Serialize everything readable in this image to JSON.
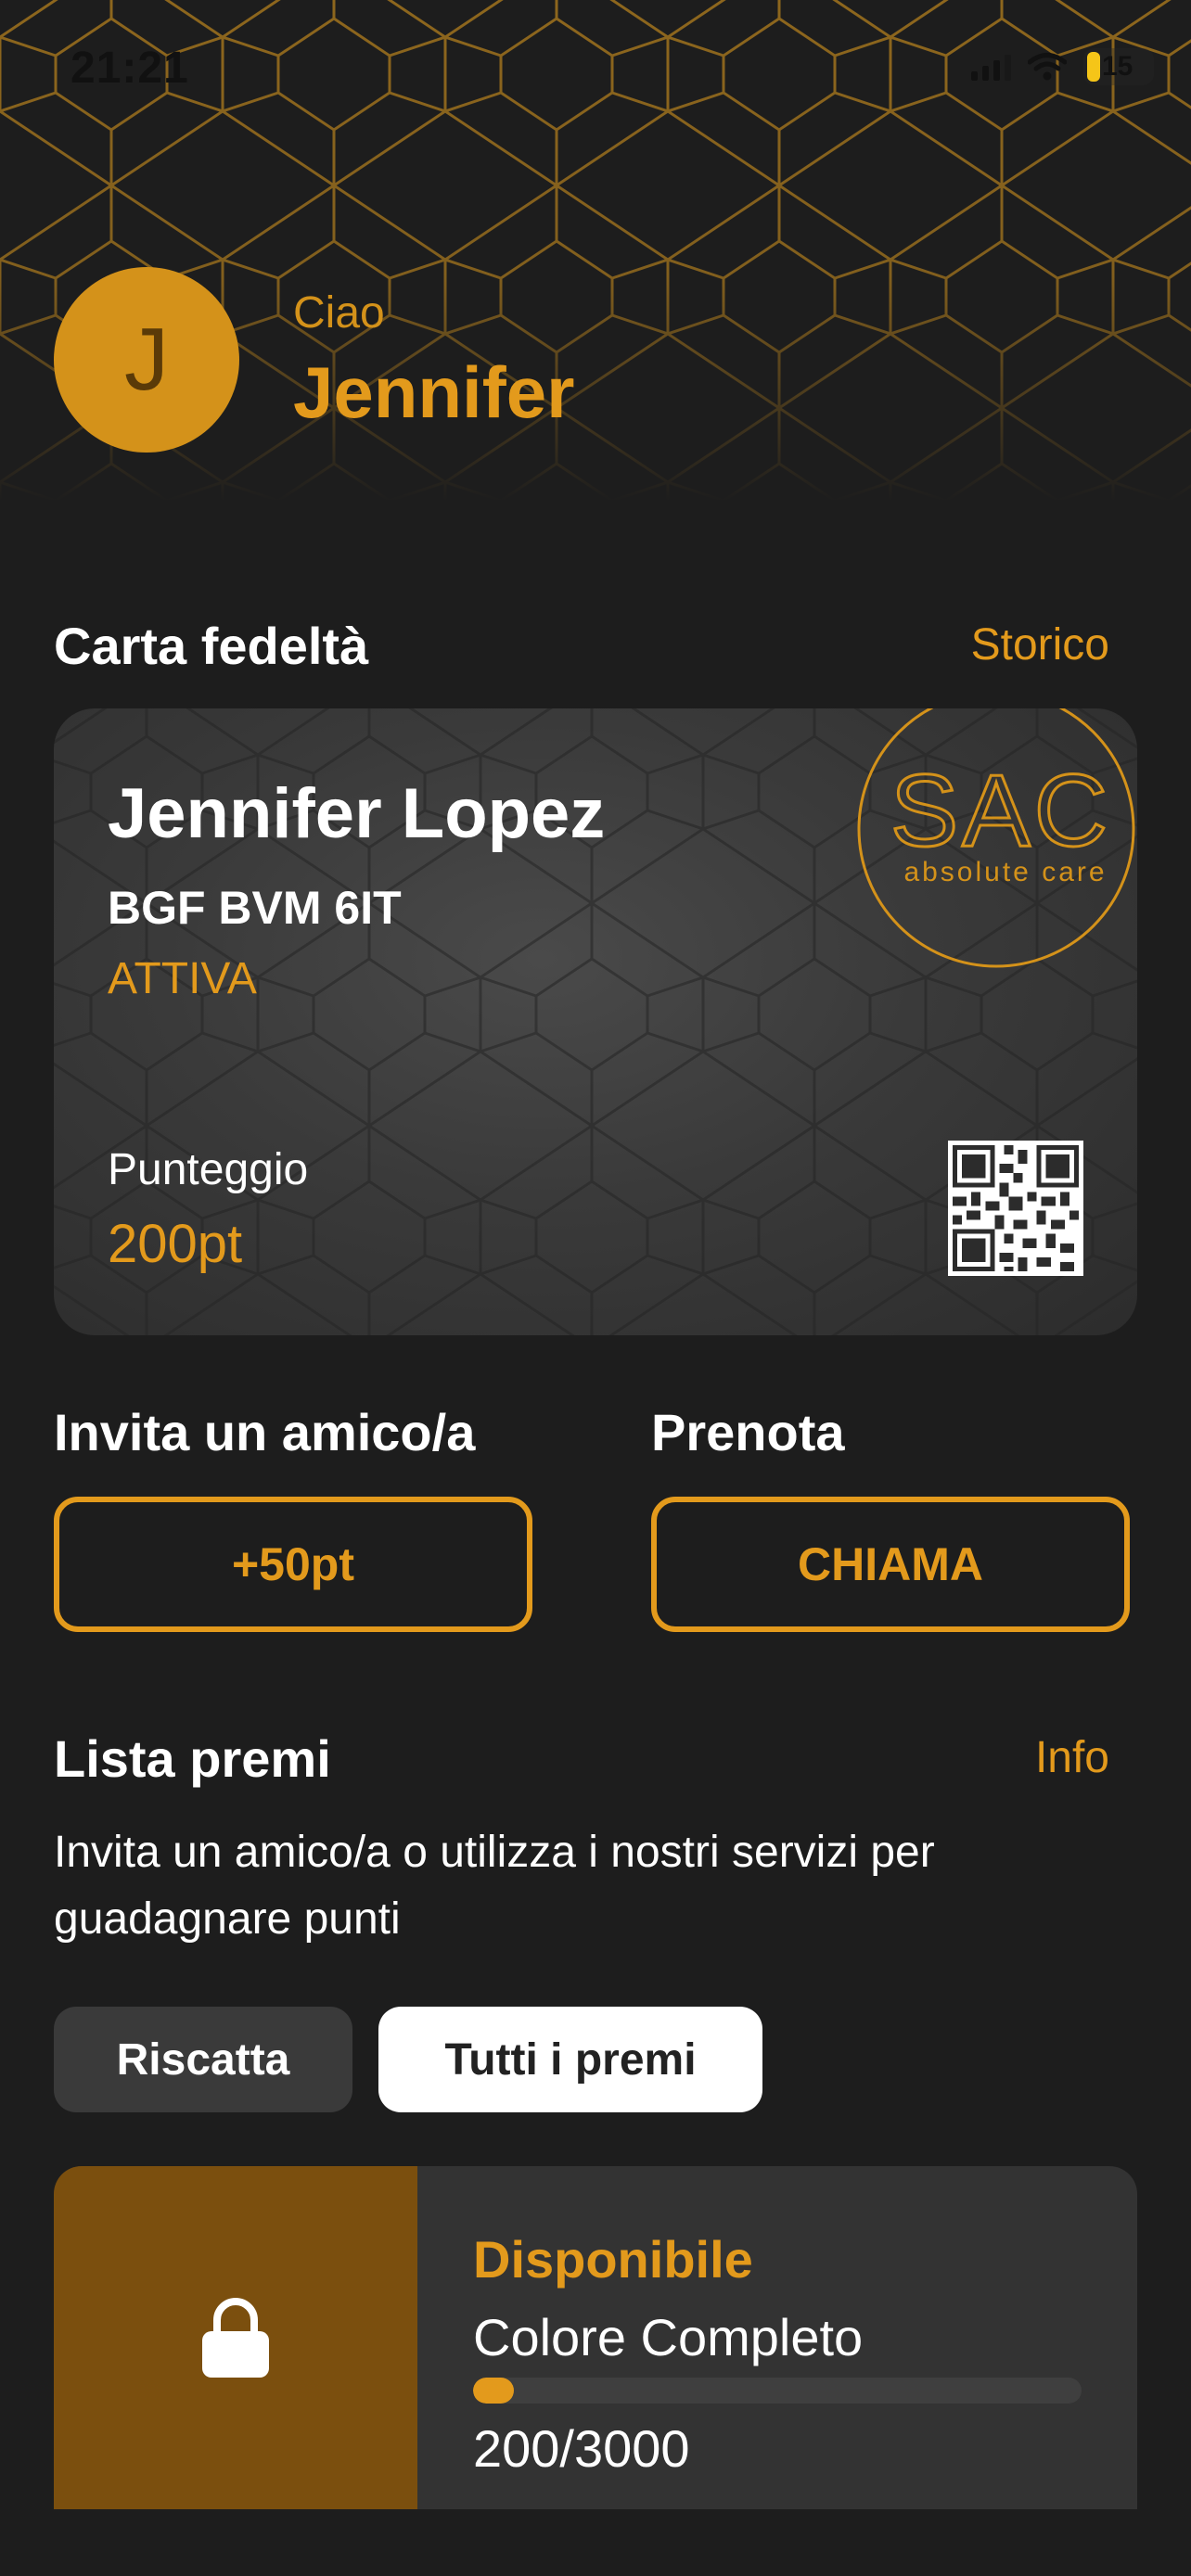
{
  "status_bar": {
    "time": "21:21",
    "battery": "15"
  },
  "greeting": {
    "avatar_initial": "J",
    "hello": "Ciao",
    "name": "Jennifer"
  },
  "loyalty": {
    "title": "Carta fedeltà",
    "history_link": "Storico",
    "card": {
      "holder_name": "Jennifer Lopez",
      "code": "BGF BVM 6IT",
      "status": "ATTIVA",
      "points_label": "Punteggio",
      "points": "200pt",
      "logo_text": "SAC",
      "logo_subtitle": "absolute care"
    }
  },
  "actions": {
    "invite": {
      "title": "Invita un amico/a",
      "button": "+50pt"
    },
    "book": {
      "title": "Prenota",
      "button": "CHIAMA"
    }
  },
  "rewards": {
    "title": "Lista premi",
    "info_link": "Info",
    "description": "Invita un amico/a o utilizza i nostri servizi per guadagnare punti",
    "tabs": [
      "Riscatta",
      "Tutti i premi"
    ],
    "active_tab": "Tutti i premi",
    "items": [
      {
        "status": "Disponibile",
        "name": "Colore Completo",
        "score": "200/3000",
        "progress": 0.067,
        "icon": "lock-icon"
      }
    ]
  },
  "colors": {
    "accent": "#e39a1c",
    "background": "#1d1d1d",
    "card": "#3a3a3a",
    "lock_pane": "#7b4f0e"
  }
}
